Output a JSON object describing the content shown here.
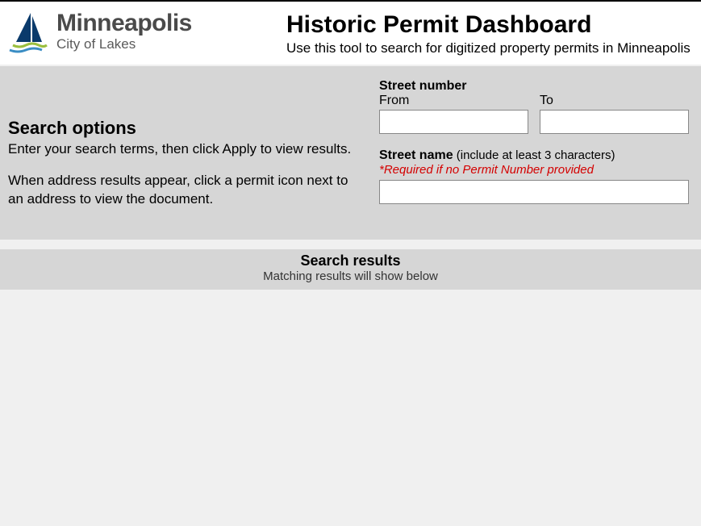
{
  "header": {
    "logo_city": "Minneapolis",
    "logo_tagline": "City of Lakes",
    "title": "Historic Permit Dashboard",
    "subtitle": "Use this tool to search for digitized property permits in Minneapolis"
  },
  "search": {
    "options_title": "Search options",
    "options_text_1": "Enter your search terms, then click Apply to view results.",
    "options_text_2": "When address results appear, click a permit icon next to an address to view the document.",
    "street_number_label": "Street number",
    "from_label": "From",
    "to_label": "To",
    "street_name_label": "Street name",
    "street_name_hint": " (include at least 3 characters)",
    "required_note": "*Required if no Permit Number provided"
  },
  "results": {
    "title": "Search results",
    "subtitle": "Matching results will show below"
  }
}
